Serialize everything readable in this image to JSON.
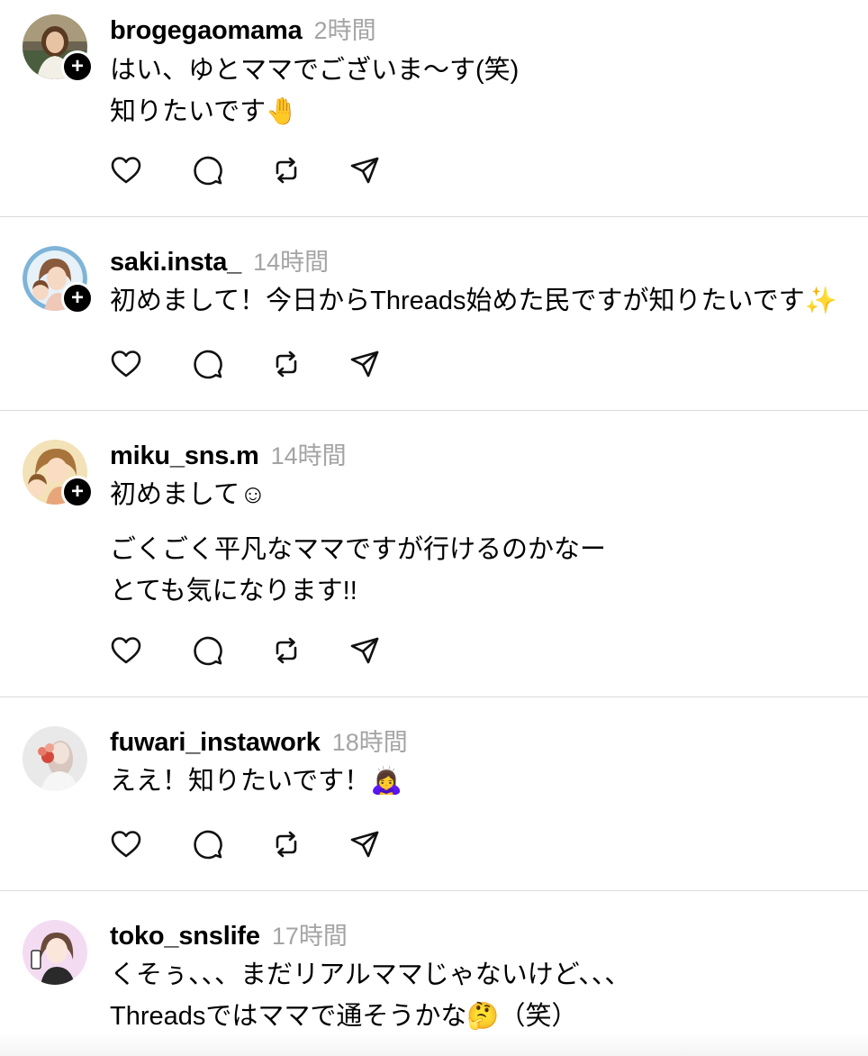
{
  "posts": [
    {
      "username": "brogegaomama",
      "time": "2時間",
      "lines": [
        "はい、ゆとママでございま〜す(笑)",
        "知りたいです🤚"
      ],
      "following_badge": true,
      "avatar_icon": "avatar-woman-kitchen"
    },
    {
      "username": "saki.insta_",
      "time": "14時間",
      "lines": [
        "初めまして！今日からThreads始めた民ですが知りたいです✨"
      ],
      "following_badge": true,
      "avatar_icon": "avatar-mother-child-illustration"
    },
    {
      "username": "miku_sns.m",
      "time": "14時間",
      "lines": [
        "初めまして☺︎",
        "",
        "ごくごく平凡なママですが行けるのかなー",
        "とても気になります!!"
      ],
      "following_badge": true,
      "avatar_icon": "avatar-mother-children-illustration"
    },
    {
      "username": "fuwari_instawork",
      "time": "18時間",
      "lines": [
        "ええ！知りたいです！🙇‍♀️"
      ],
      "following_badge": false,
      "avatar_icon": "avatar-woman-flowers"
    },
    {
      "username": "toko_snslife",
      "time": "17時間",
      "lines": [
        "くそぅ、、、まだリアルママじゃないけど、、、",
        "Threadsではママで通そうかな🤔（笑）"
      ],
      "following_badge": false,
      "avatar_icon": "avatar-woman-phone-illustration"
    }
  ],
  "actions": [
    "heart-icon",
    "comment-icon",
    "repost-icon",
    "share-icon"
  ],
  "colors": {
    "timestamp": "#a4a4a4",
    "divider": "#dbdbdb",
    "text": "#000000"
  }
}
